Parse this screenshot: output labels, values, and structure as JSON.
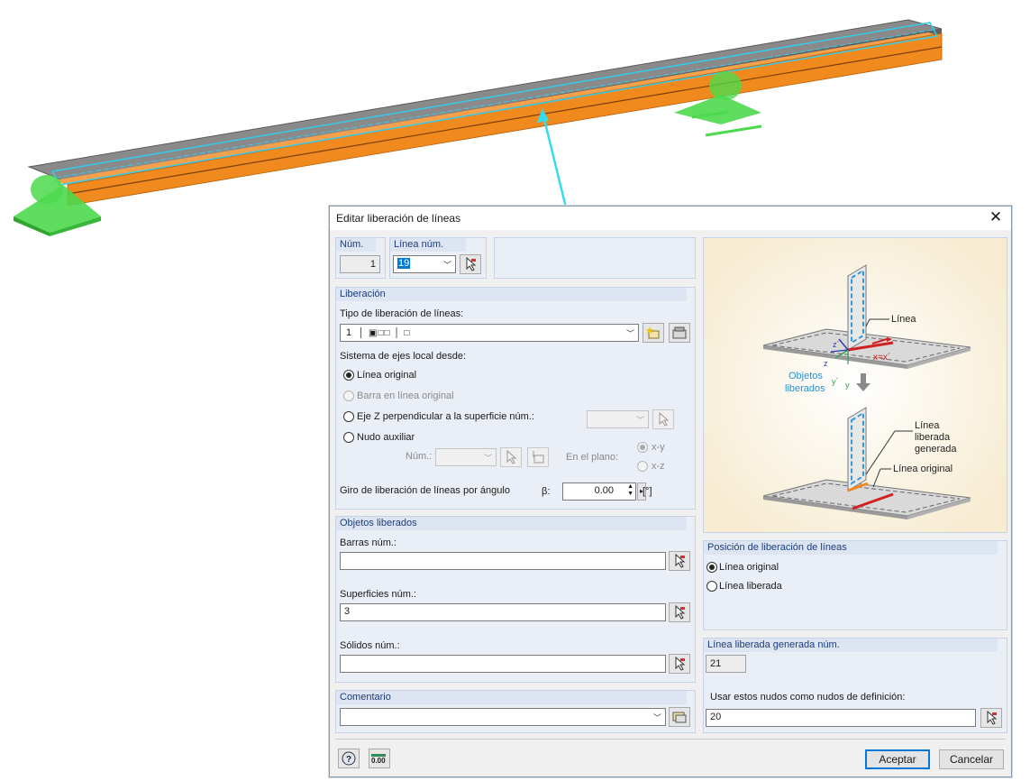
{
  "dialog": {
    "title": "Editar liberación de líneas",
    "num": {
      "label": "Núm.",
      "value": "1"
    },
    "linea_num": {
      "label": "Línea núm.",
      "value": "19"
    },
    "liberacion": {
      "header": "Liberación",
      "tipo_label": "Tipo de liberación de líneas:",
      "tipo_value": "1",
      "sistema_label": "Sistema de ejes local desde:",
      "options": [
        "Línea original",
        "Barra en línea original",
        "Eje Z perpendicular a la superficie núm.:",
        "Nudo auxiliar"
      ],
      "nudo_num_label": "Núm.:",
      "plano_label": "En el plano:",
      "plano_options": [
        "x-y",
        "x-z"
      ],
      "giro_label": "Giro de liberación de líneas por ángulo",
      "beta_label": "β:",
      "giro_value": "0.00",
      "giro_unit": "[°]"
    },
    "objetos": {
      "header": "Objetos liberados",
      "barras_label": "Barras núm.:",
      "barras_value": "",
      "superficies_label": "Superficies núm.:",
      "superficies_value": "3",
      "solidos_label": "Sólidos núm.:",
      "solidos_value": ""
    },
    "comentario": {
      "header": "Comentario",
      "value": ""
    },
    "diagram": {
      "linea": "Línea",
      "objetos_liberados_1": "Objetos",
      "objetos_liberados_2": "liberados",
      "linea_liberada_1": "Línea",
      "linea_liberada_2": "liberada",
      "linea_liberada_3": "generada",
      "linea_original": "Línea original",
      "axis_z1": "z´",
      "axis_z": "z",
      "axis_y1": "y´",
      "axis_y": "y",
      "axis_x": "x=x´"
    },
    "posicion": {
      "header": "Posición de liberación de líneas",
      "options": [
        "Línea original",
        "Línea liberada"
      ]
    },
    "generada": {
      "header": "Línea liberada generada núm.",
      "value": "21",
      "nudos_label": "Usar estos nudos como nudos de definición:",
      "nudos_value": "20"
    },
    "footer": {
      "units_icon_text": "0.00",
      "ok": "Aceptar",
      "cancel": "Cancelar"
    }
  },
  "colors": {
    "beam": "#f08a1e",
    "support": "#4cd94c",
    "slab": "#7a7a7a",
    "highlight": "#33ccee",
    "dialog_group": "#e9eef7",
    "group_header_text": "#1c3d7a"
  }
}
